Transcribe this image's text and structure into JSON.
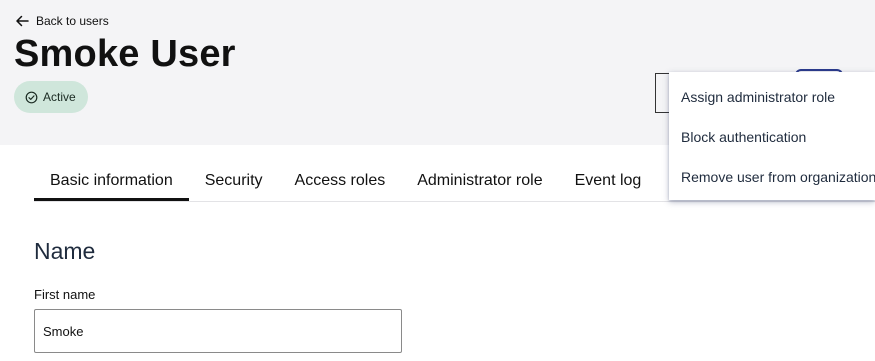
{
  "header": {
    "back_label": "Back to users",
    "title": "Smoke User",
    "status": "Active"
  },
  "tabs": [
    {
      "label": "Basic information",
      "active": true
    },
    {
      "label": "Security",
      "active": false
    },
    {
      "label": "Access roles",
      "active": false
    },
    {
      "label": "Administrator role",
      "active": false
    },
    {
      "label": "Event log",
      "active": false
    }
  ],
  "main": {
    "section_title": "Name",
    "first_name_label": "First name",
    "first_name_value": "Smoke"
  },
  "menu": {
    "items": [
      "Assign administrator role",
      "Block authentication",
      "Remove user from organization"
    ]
  },
  "icons": {
    "back": "arrow-left-icon",
    "status": "check-circle-icon"
  },
  "colors": {
    "header_bg": "#f4f4f6",
    "badge_bg": "#cfe6db",
    "text_dark": "#1f2b3d",
    "accent": "#2a3a8c"
  }
}
